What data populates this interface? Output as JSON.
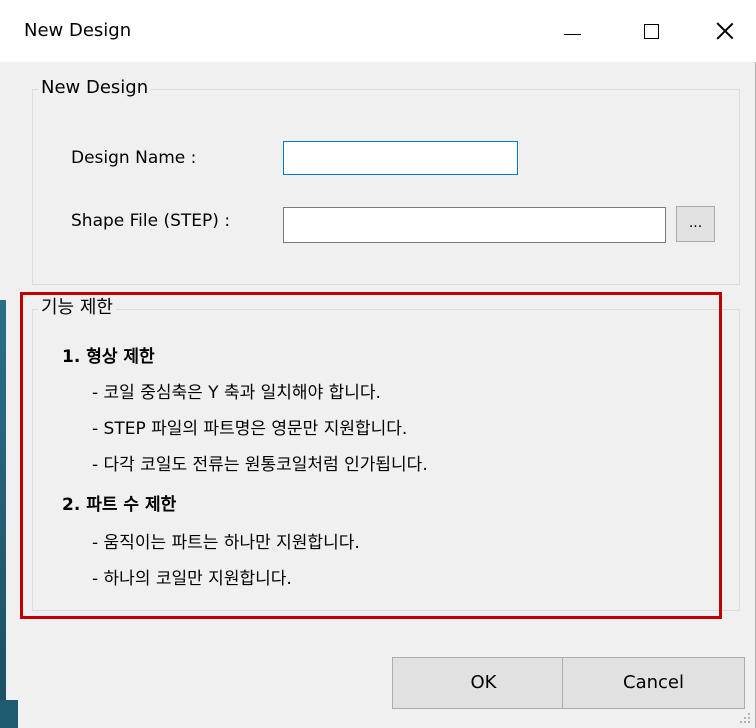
{
  "window": {
    "title": "New Design"
  },
  "group_new": {
    "legend": "New Design",
    "design_name_label": "Design Name :",
    "design_name_value": "",
    "shape_file_label": "Shape File (STEP) :",
    "shape_file_value": "",
    "browse_label": "..."
  },
  "group_limits": {
    "legend": "기능 제한",
    "sections": [
      {
        "title": "1. 형상 제한",
        "items": [
          "- 코일 중심축은 Y 축과 일치해야 합니다.",
          "- STEP 파일의 파트명은 영문만 지원합니다.",
          "- 다각 코일도 전류는 원통코일처럼 인가됩니다."
        ]
      },
      {
        "title": "2. 파트 수 제한",
        "items": [
          "- 움직이는 파트는 하나만 지원합니다.",
          "- 하나의 코일만 지원합니다."
        ]
      }
    ]
  },
  "buttons": {
    "ok": "OK",
    "cancel": "Cancel"
  },
  "colors": {
    "highlight_border": "#c00000",
    "focus_border": "#0078d7"
  }
}
